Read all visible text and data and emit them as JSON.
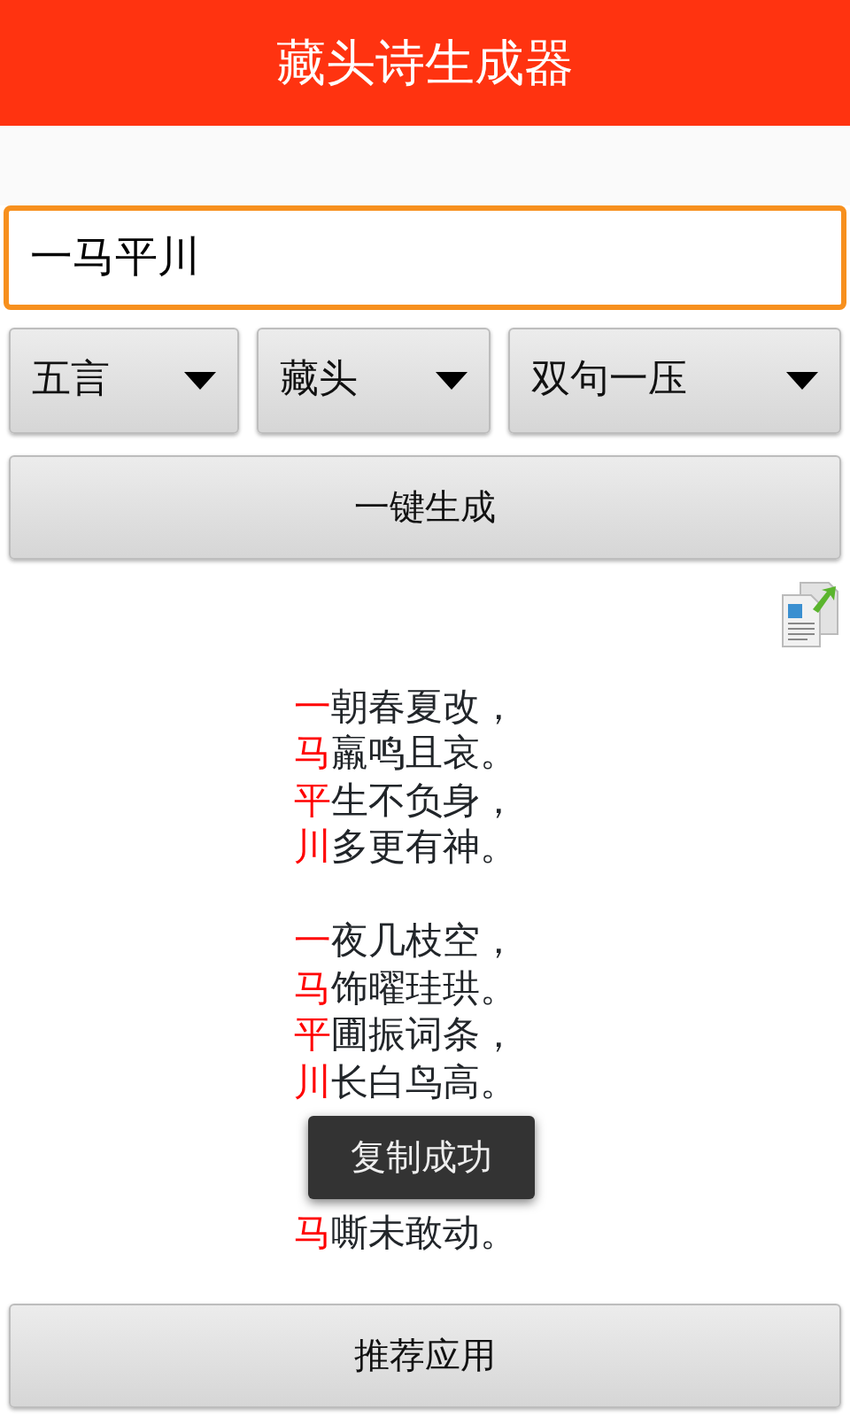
{
  "app_bar": {
    "title": "藏头诗生成器"
  },
  "input": {
    "value": "一马平川"
  },
  "spinners": [
    {
      "label": "五言"
    },
    {
      "label": "藏头"
    },
    {
      "label": "双句一压"
    }
  ],
  "generate_button": "一键生成",
  "stanzas": [
    {
      "lines": [
        {
          "head": "一",
          "rest": "朝春夏改，"
        },
        {
          "head": "马",
          "rest": "羸鸣且哀。"
        },
        {
          "head": "平",
          "rest": "生不负身，"
        },
        {
          "head": "川",
          "rest": "多更有神。"
        }
      ]
    },
    {
      "lines": [
        {
          "head": "一",
          "rest": "夜几枝空，"
        },
        {
          "head": "马",
          "rest": "饰曜珪珙。"
        },
        {
          "head": "平",
          "rest": "圃振词条，"
        },
        {
          "head": "川",
          "rest": "长白鸟高。"
        }
      ]
    },
    {
      "lines": [
        {
          "head": "马",
          "rest": "嘶未敢动。"
        }
      ]
    }
  ],
  "toast": "复制成功",
  "bottom_button": "推荐应用"
}
